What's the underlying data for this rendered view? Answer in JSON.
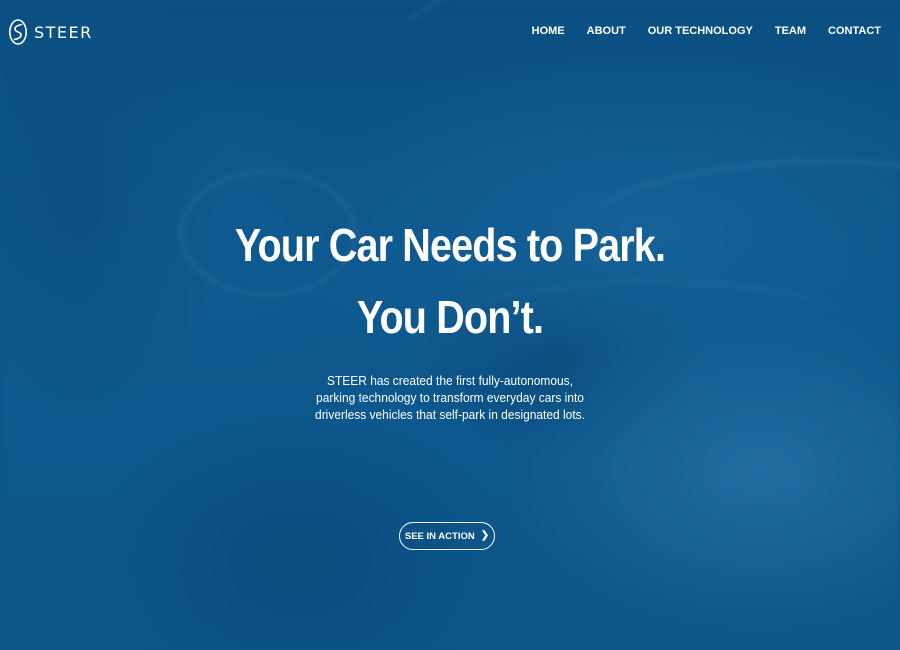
{
  "brand": {
    "name": "STEER",
    "logo_icon": "steer-s-logo-icon"
  },
  "nav": {
    "items": [
      {
        "label": "HOME"
      },
      {
        "label": "ABOUT"
      },
      {
        "label": "OUR TECHNOLOGY"
      },
      {
        "label": "TEAM"
      },
      {
        "label": "CONTACT"
      }
    ]
  },
  "hero": {
    "headline_line1": "Your Car Needs to Park.",
    "headline_line2": "You Don’t.",
    "description_lines": [
      "STEER has created the first fully-autonomous,",
      "parking technology to transform everyday cars into",
      "driverless vehicles that self-park in designated lots."
    ],
    "cta_label": "SEE IN ACTION",
    "cta_icon": "chevron-right-icon"
  },
  "colors": {
    "background_tint": "#0d5a8e",
    "text": "#ffffff"
  }
}
